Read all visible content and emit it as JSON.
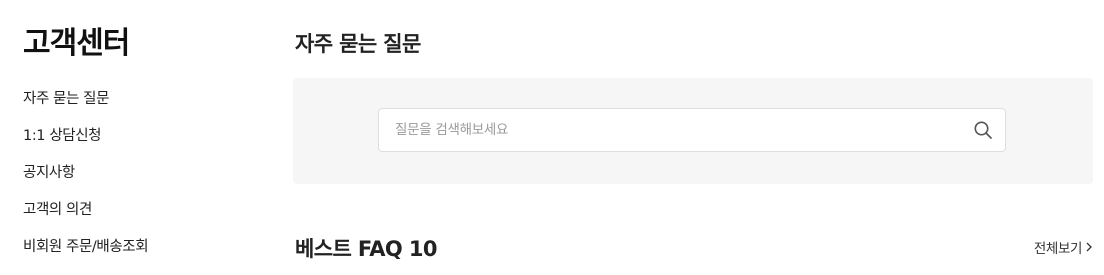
{
  "sidebar": {
    "title": "고객센터",
    "items": [
      {
        "label": "자주 묻는 질문"
      },
      {
        "label": "1:1 상담신청"
      },
      {
        "label": "공지사항"
      },
      {
        "label": "고객의 의견"
      },
      {
        "label": "비회원 주문/배송조회"
      }
    ]
  },
  "main": {
    "title": "자주 묻는 질문",
    "search": {
      "placeholder": "질문을 검색해보세요",
      "value": "",
      "icon": "search-icon"
    },
    "best_faq": {
      "title": "베스트 FAQ 10",
      "view_all_label": "전체보기",
      "view_all_icon": "chevron-right-icon"
    }
  },
  "colors": {
    "panel_bg": "#f6f6f6",
    "text_primary": "#111111",
    "placeholder": "#9a9a9a",
    "border": "#dedede"
  }
}
